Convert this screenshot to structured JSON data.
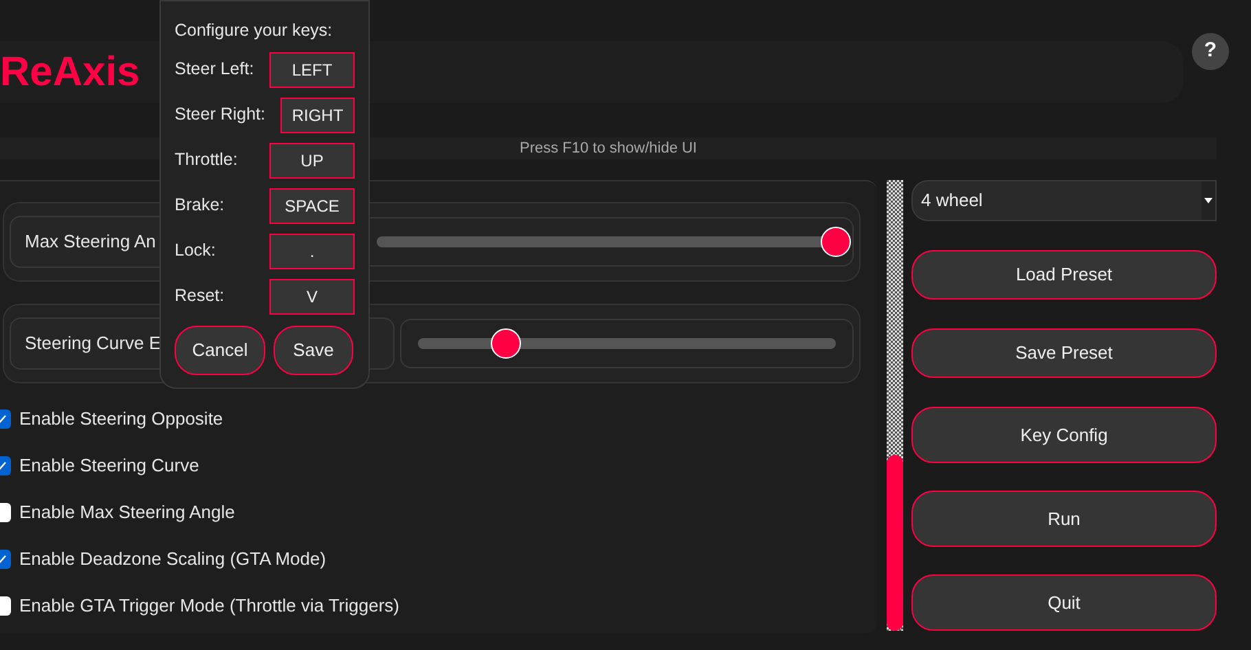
{
  "app_title": "ReAxis",
  "help_button": "?",
  "hint": "Press F10 to show/hide UI",
  "sliders": [
    {
      "label": "Max Steering An",
      "level": 1.0
    },
    {
      "label": "Steering Curve E",
      "level": 0.21
    }
  ],
  "options": [
    {
      "label": "Enable Steering Opposite",
      "checked": true
    },
    {
      "label": "Enable Steering Curve",
      "checked": true
    },
    {
      "label": "Enable Max Steering Angle",
      "checked": false
    },
    {
      "label": "Enable Deadzone Scaling (GTA Mode)",
      "checked": true
    },
    {
      "label": "Enable GTA Trigger Mode (Throttle via Triggers)",
      "checked": false
    }
  ],
  "meter": {
    "level": 0.39
  },
  "vehicle_select": {
    "value": "4 wheel"
  },
  "buttons": [
    "Load Preset",
    "Save Preset",
    "Key Config",
    "Run",
    "Quit"
  ],
  "key_dialog": {
    "title": "Configure your keys:",
    "keys": [
      {
        "label": "Steer Left:",
        "value": "LEFT"
      },
      {
        "label": "Steer Right:",
        "value": "RIGHT"
      },
      {
        "label": "Throttle:",
        "value": "UP"
      },
      {
        "label": "Brake:",
        "value": "SPACE"
      },
      {
        "label": "Lock:",
        "value": "."
      },
      {
        "label": "Reset:",
        "value": "V"
      }
    ],
    "buttons": [
      "Cancel",
      "Save"
    ]
  }
}
